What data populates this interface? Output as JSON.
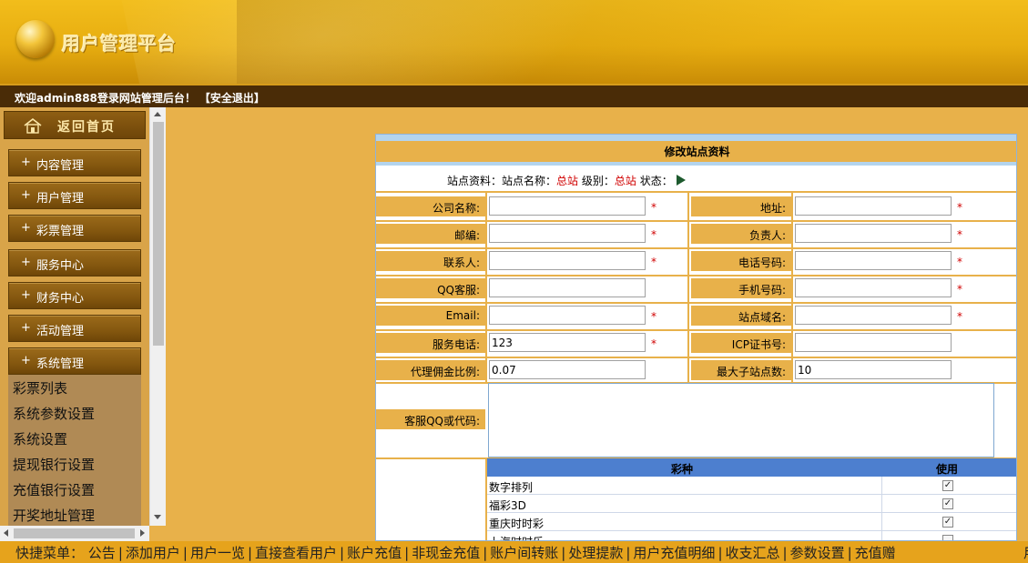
{
  "header": {
    "logo_text": "用户管理平台"
  },
  "welcome": {
    "text": "欢迎admin888登录网站管理后台！",
    "logout": "【安全退出】"
  },
  "sidebar": {
    "home_label": "返回首页",
    "menu": [
      {
        "plus": "+",
        "label": "内容管理"
      },
      {
        "plus": "+",
        "label": "用户管理"
      },
      {
        "plus": "+",
        "label": "彩票管理"
      },
      {
        "plus": "+",
        "label": "服务中心"
      },
      {
        "plus": "+",
        "label": "财务中心"
      },
      {
        "plus": "+",
        "label": "活动管理"
      },
      {
        "plus": "+",
        "label": "系统管理"
      }
    ],
    "submenu": [
      "彩票列表",
      "系统参数设置",
      "系统设置",
      "提现银行设置",
      "充值银行设置",
      "开奖地址管理"
    ]
  },
  "form": {
    "title": "修改站点资料",
    "site_info": {
      "prefix": "站点资料：站点名称：",
      "site_name": "总站",
      "level_label": "级别：",
      "level": "总站",
      "status_label": "状态："
    },
    "fields": {
      "company": {
        "label": "公司名称:",
        "value": "",
        "required": "*"
      },
      "address": {
        "label": "地址:",
        "value": "",
        "required": "*"
      },
      "postcode": {
        "label": "邮编:",
        "value": "",
        "required": "*"
      },
      "manager": {
        "label": "负责人:",
        "value": "",
        "required": "*"
      },
      "contact": {
        "label": "联系人:",
        "value": "",
        "required": "*"
      },
      "phone": {
        "label": "电话号码:",
        "value": "",
        "required": "*"
      },
      "qq": {
        "label": "QQ客服:",
        "value": ""
      },
      "mobile": {
        "label": "手机号码:",
        "value": "",
        "required": "*"
      },
      "email": {
        "label": "Email:",
        "value": "",
        "required": "*"
      },
      "domain": {
        "label": "站点域名:",
        "value": "",
        "required": "*"
      },
      "service_phone": {
        "label": "服务电话:",
        "value": "123",
        "required": "*"
      },
      "icp": {
        "label": "ICP证书号:",
        "value": ""
      },
      "commission": {
        "label": "代理佣金比例:",
        "value": "0.07"
      },
      "max_subsites": {
        "label": "最大子站点数:",
        "value": "10"
      },
      "qq_code": {
        "label": "客服QQ或代码:",
        "value": ""
      }
    },
    "lottery": {
      "col_name": "彩种",
      "col_use": "使用",
      "rows": [
        {
          "name": "数字排列",
          "checked": "✓"
        },
        {
          "name": "福彩3D",
          "checked": "✓"
        },
        {
          "name": "重庆时时彩",
          "checked": "✓"
        },
        {
          "name": "上海时时乐",
          "checked": ""
        }
      ]
    }
  },
  "quickbar": {
    "prefix": "快捷菜单：",
    "items": [
      "公告",
      "添加用户",
      "用户一览",
      "直接查看用户",
      "账户充值",
      "非现金充值",
      "账户间转账",
      "处理提款",
      "用户充值明细",
      "收支汇总",
      "参数设置",
      "充值赠"
    ],
    "trailing": "用"
  },
  "colors": {
    "accent": "#e8b14a",
    "header_dark": "#4a2c07",
    "required": "#d00000",
    "table_head": "#4d7fcf"
  }
}
